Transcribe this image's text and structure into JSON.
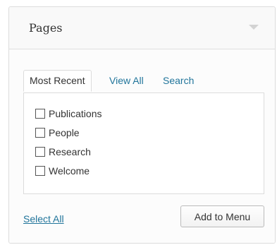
{
  "panel": {
    "title": "Pages",
    "toggle_icon": "triangle-down-icon"
  },
  "tabs": [
    {
      "label": "Most Recent",
      "active": true
    },
    {
      "label": "View All",
      "active": false
    },
    {
      "label": "Search",
      "active": false
    }
  ],
  "items": [
    {
      "label": "Publications",
      "checked": false
    },
    {
      "label": "People",
      "checked": false
    },
    {
      "label": "Research",
      "checked": false
    },
    {
      "label": "Welcome",
      "checked": false
    }
  ],
  "footer": {
    "select_all": "Select All",
    "add_button": "Add to Menu"
  },
  "colors": {
    "link": "#21759b",
    "text": "#333333",
    "border": "#dcdcdc"
  }
}
